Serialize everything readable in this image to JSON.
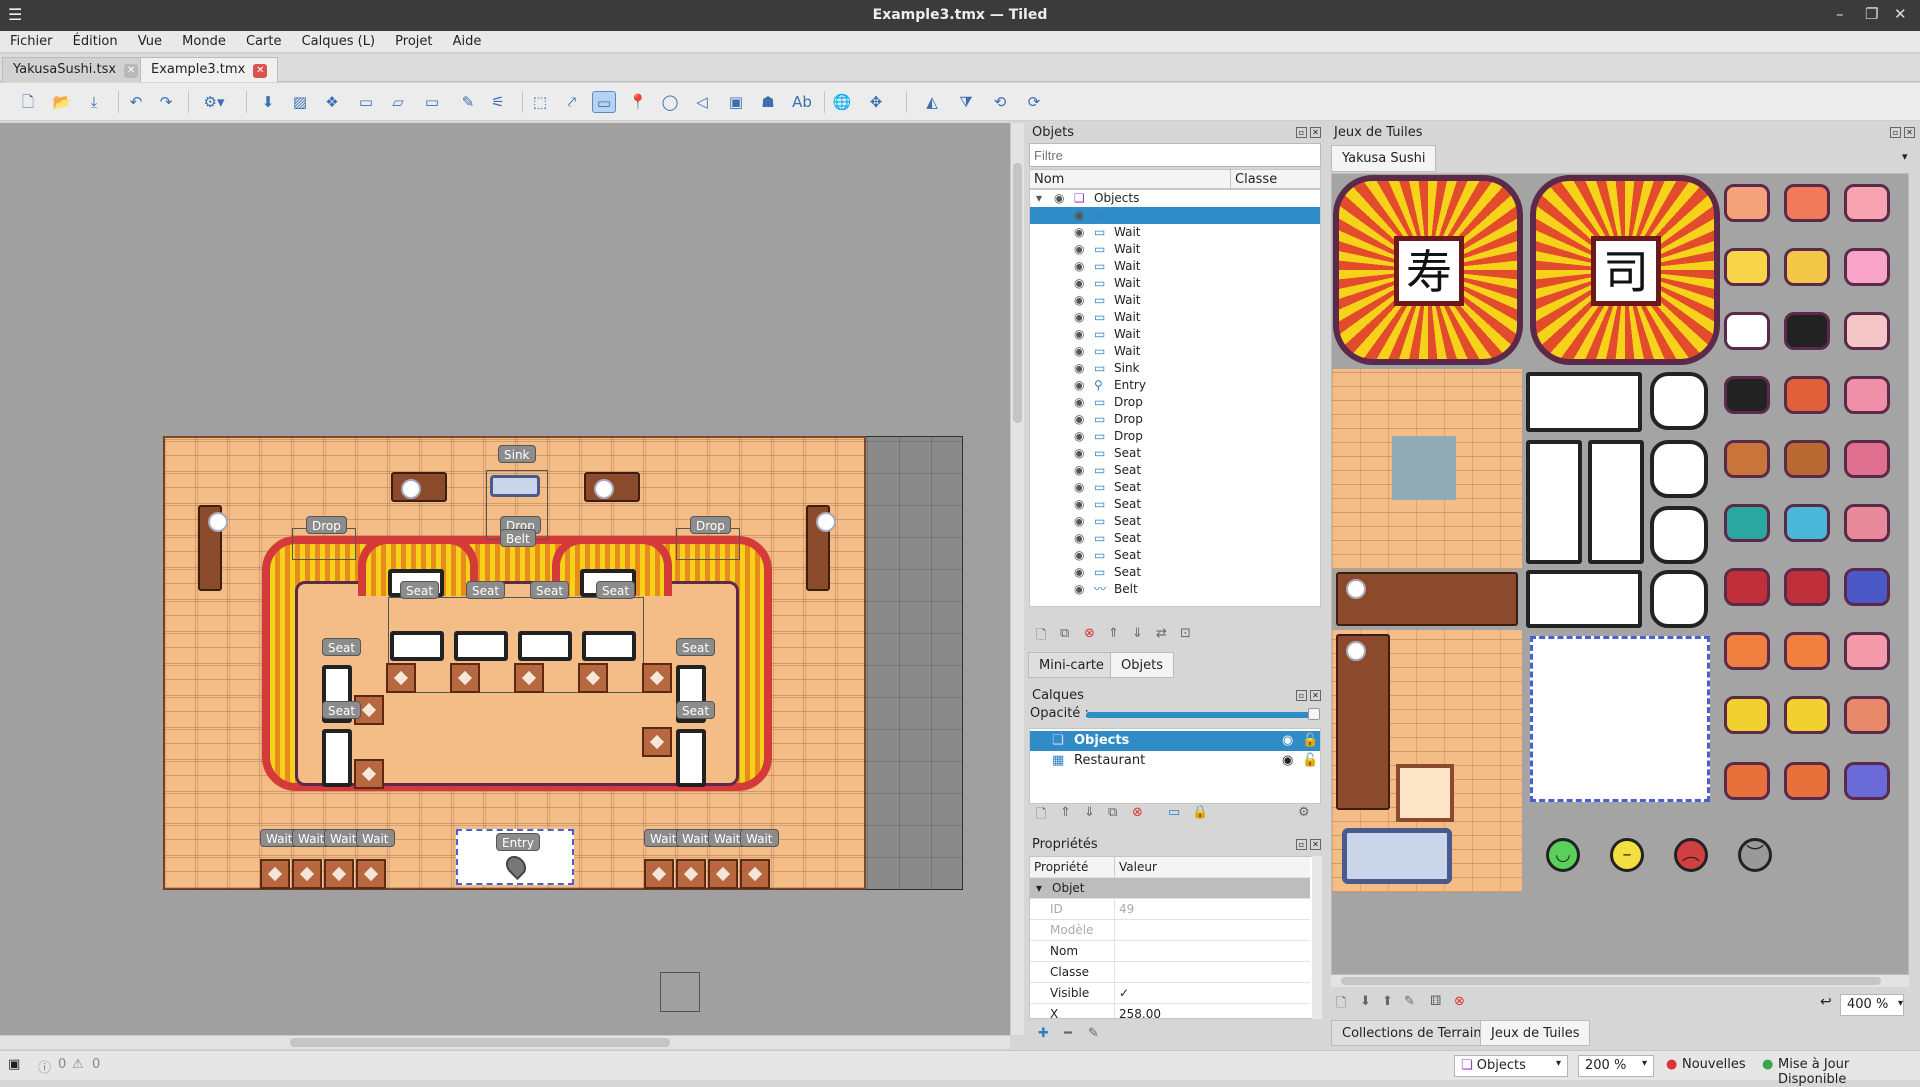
{
  "window": {
    "title": "Example3.tmx — Tiled"
  },
  "menu": [
    "Fichier",
    "Édition",
    "Vue",
    "Monde",
    "Carte",
    "Calques (L)",
    "Projet",
    "Aide"
  ],
  "tabs": [
    {
      "label": "YakusaSushi.tsx"
    },
    {
      "label": "Example3.tmx"
    }
  ],
  "map_labels": {
    "sink": "Sink",
    "drop": "Drop",
    "drop_belt_1": "Drop",
    "drop_belt_2": "Belt",
    "seat": "Seat",
    "wait": "Wait",
    "entry": "Entry"
  },
  "objects_panel": {
    "title": "Objets",
    "filter_placeholder": "Filtre",
    "columns": [
      "Nom",
      "Classe"
    ],
    "root": "Objects",
    "items": [
      "",
      "Wait",
      "Wait",
      "Wait",
      "Wait",
      "Wait",
      "Wait",
      "Wait",
      "Wait",
      "Sink",
      "Entry",
      "Drop",
      "Drop",
      "Drop",
      "Seat",
      "Seat",
      "Seat",
      "Seat",
      "Seat",
      "Seat",
      "Seat",
      "Seat",
      "Belt"
    ]
  },
  "mid_tabs": [
    "Mini-carte",
    "Objets"
  ],
  "layers_panel": {
    "title": "Calques",
    "opacity_label": "Opacité :",
    "layers": [
      "Objects",
      "Restaurant"
    ]
  },
  "props_panel": {
    "title": "Propriétés",
    "col_prop": "Propriété",
    "col_val": "Valeur",
    "group": "Objet",
    "rows": [
      {
        "k": "ID",
        "v": "49"
      },
      {
        "k": "Modèle",
        "v": ""
      },
      {
        "k": "Nom",
        "v": ""
      },
      {
        "k": "Classe",
        "v": ""
      },
      {
        "k": "Visible",
        "v": "✓"
      },
      {
        "k": "X",
        "v": "258.00"
      }
    ]
  },
  "tileset_panel": {
    "title": "Jeux de Tuiles",
    "tab": "Yakusa Sushi",
    "kanji1": "寿",
    "kanji2": "司",
    "zoom": "400 %",
    "bottom_tabs": [
      "Collections de Terrains",
      "Jeux de Tuiles"
    ]
  },
  "status": {
    "errors": "0",
    "warnings": "0",
    "layer": "Objects",
    "zoom": "200 %",
    "news": "Nouvelles",
    "update": "Mise à Jour Disponible"
  },
  "colors": {
    "selection": "#308cc6",
    "brick": "#f4bd88",
    "belt_red": "#d43a3a",
    "belt_yellow": "#f7d21a"
  }
}
